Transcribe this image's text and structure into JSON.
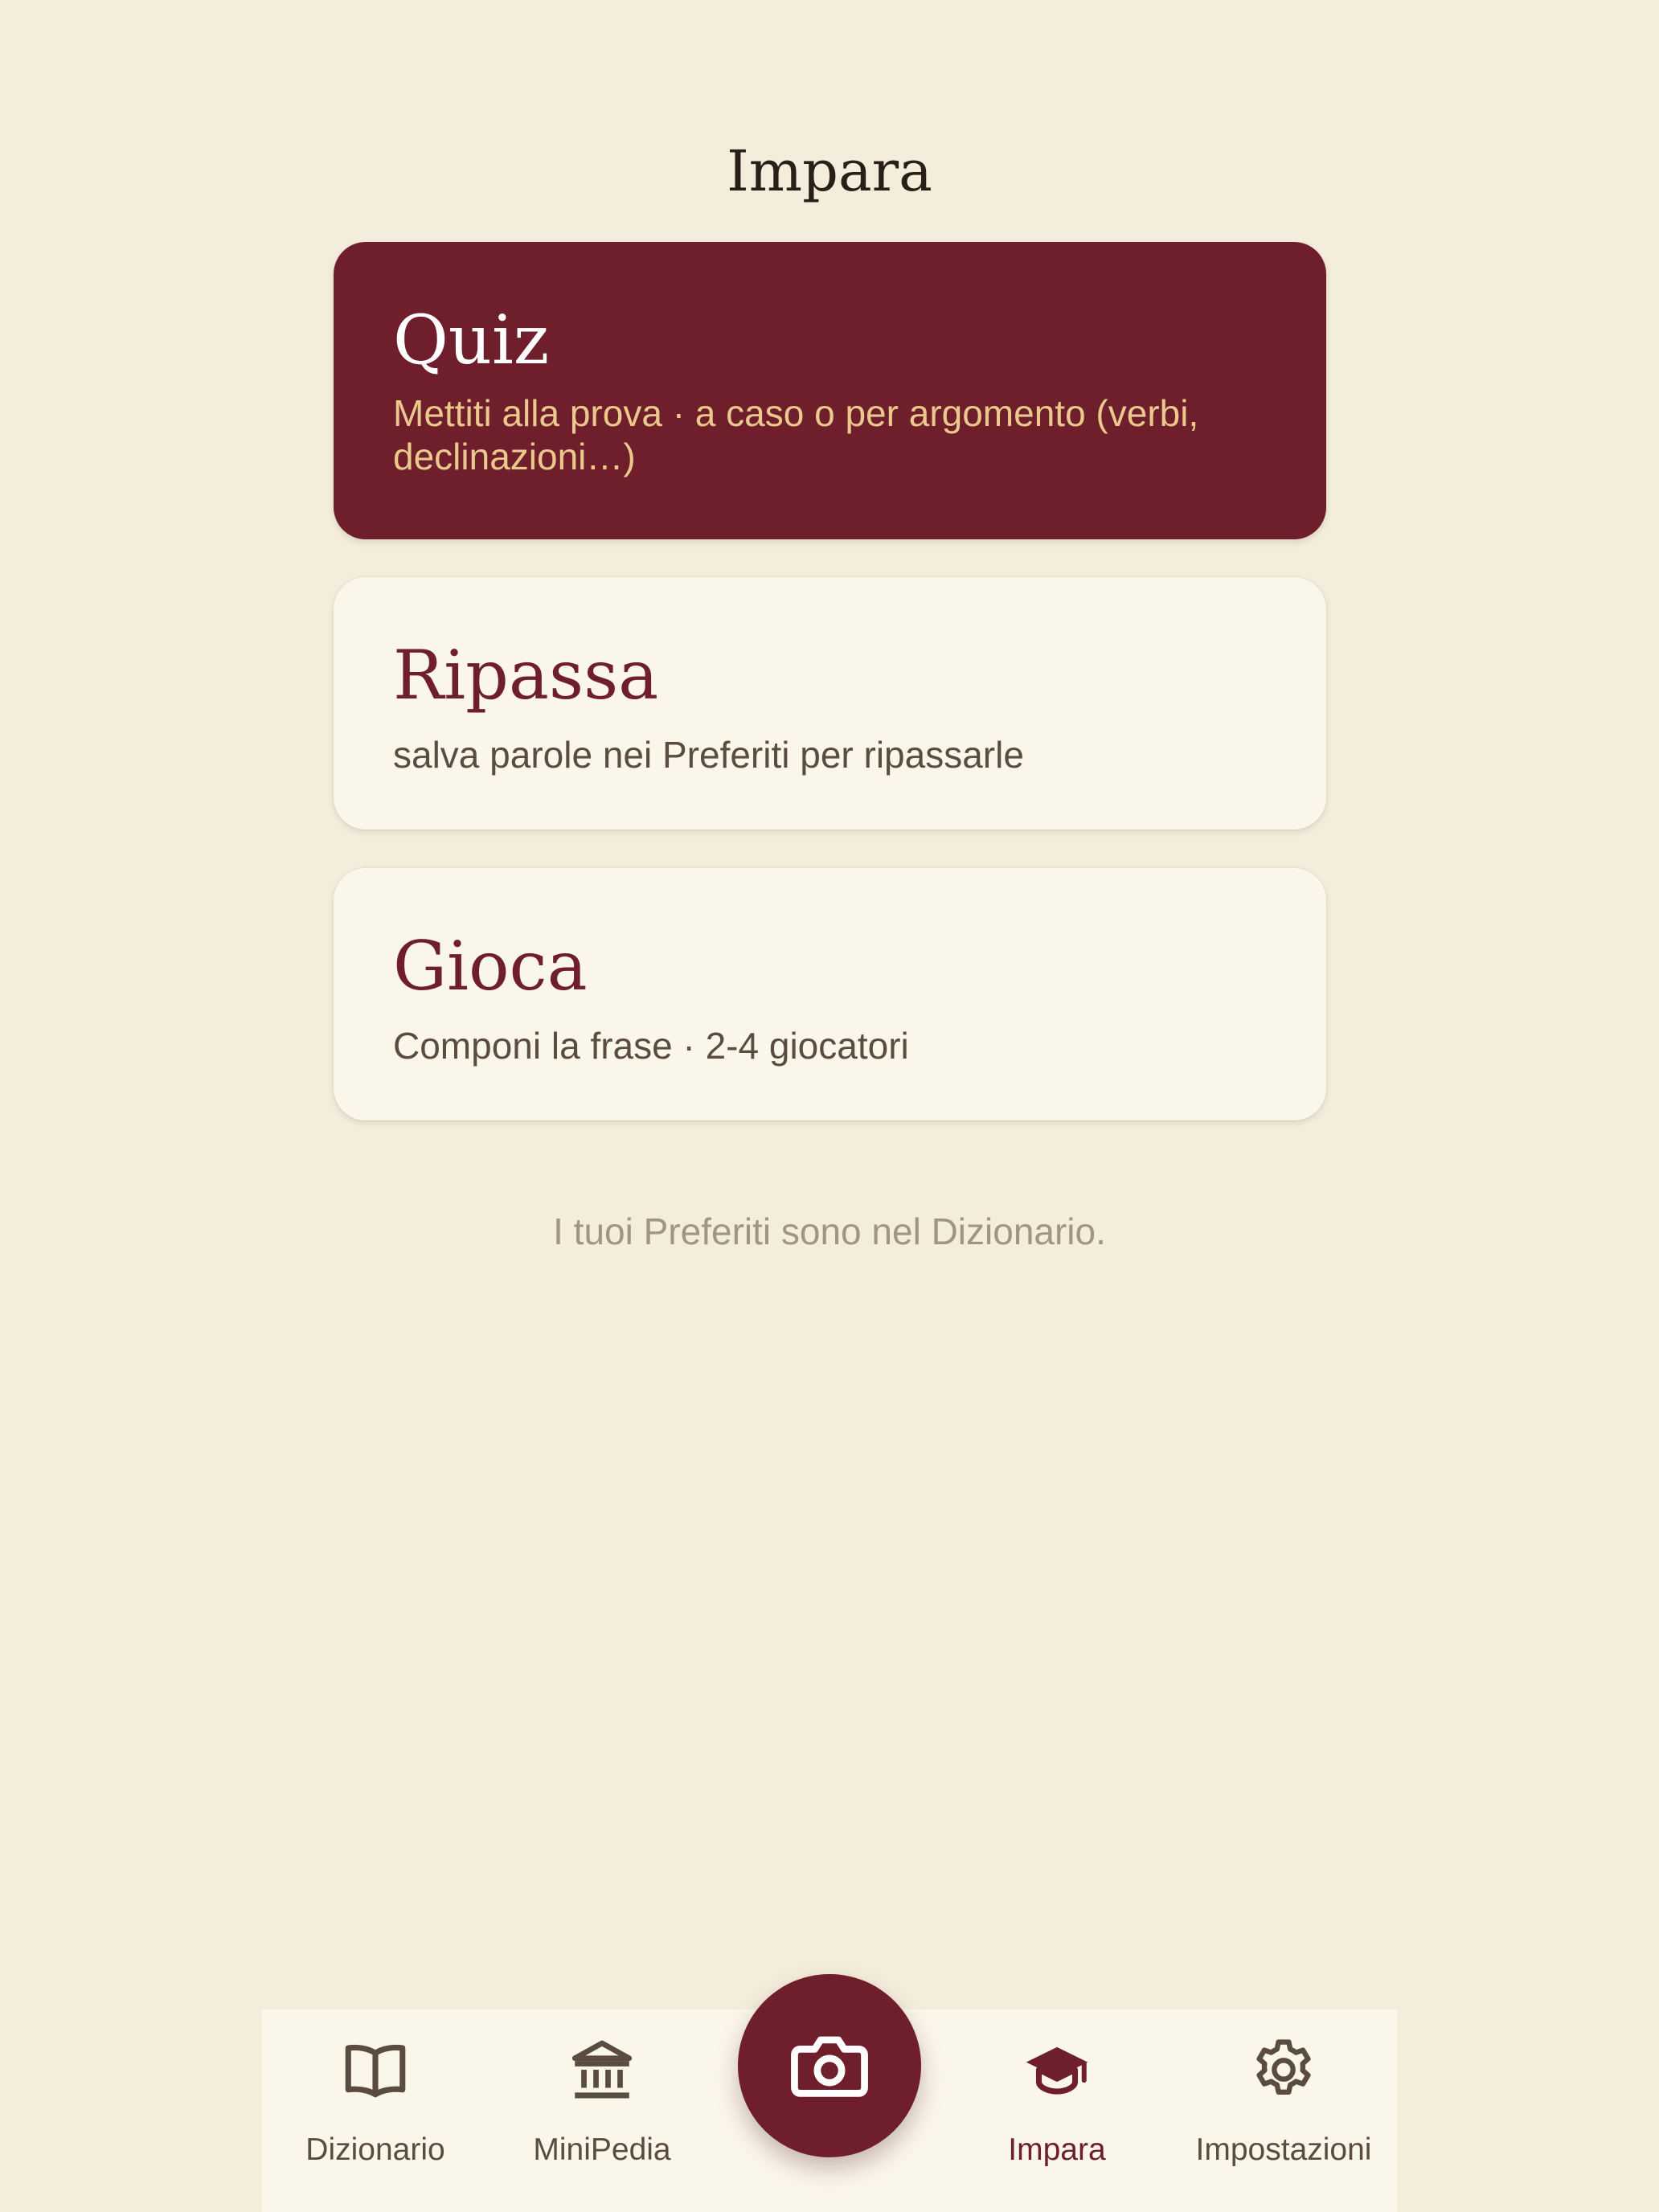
{
  "header": {
    "title": "Impara"
  },
  "cards": [
    {
      "title": "Quiz",
      "subtitle": "Mettiti alla prova · a caso o per argomento (verbi, declinazioni…)"
    },
    {
      "title": "Ripassa",
      "subtitle": "salva parole nei Preferiti per ripassarle"
    },
    {
      "title": "Gioca",
      "subtitle": "Componi la frase · 2-4 giocatori"
    }
  ],
  "footnote": "I tuoi Preferiti sono nel Dizionario.",
  "nav": {
    "items": [
      {
        "label": "Dizionario",
        "icon": "book-icon"
      },
      {
        "label": "MiniPedia",
        "icon": "museum-icon"
      },
      {
        "label": "Impara",
        "icon": "graduation-cap-icon",
        "active": true
      },
      {
        "label": "Impostazioni",
        "icon": "gear-icon"
      }
    ],
    "fab_icon": "camera-icon"
  },
  "colors": {
    "background": "#F5EDDB",
    "accent": "#6E1F2B",
    "card": "#FBF6EA",
    "quiz_subtitle": "#EBC98D"
  }
}
